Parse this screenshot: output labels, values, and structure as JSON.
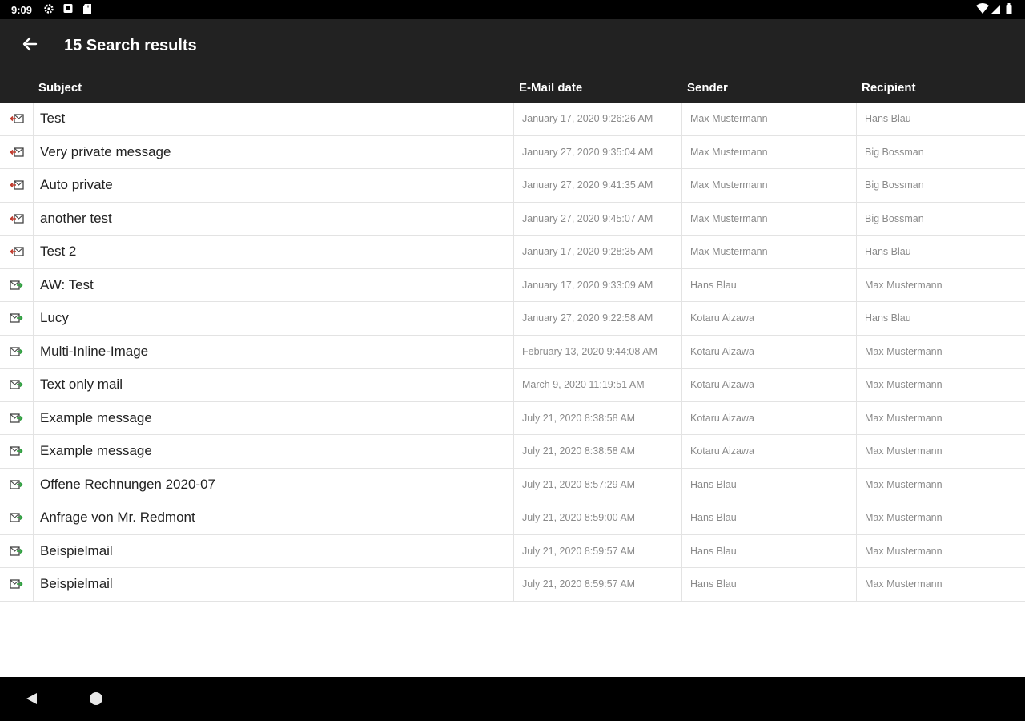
{
  "status_bar": {
    "time": "9:09",
    "left_icons": [
      "gear-icon",
      "notification-icon",
      "sd-card-icon"
    ],
    "right_icons": [
      "wifi-icon",
      "signal-icon",
      "battery-icon"
    ]
  },
  "header": {
    "title": "15 Search results",
    "back_icon": "arrow-left-icon"
  },
  "table": {
    "columns": [
      "Subject",
      "E-Mail date",
      "Sender",
      "Recipient"
    ],
    "colors": {
      "outgoing": "#c0392b",
      "incoming": "#2e9e3e"
    },
    "rows": [
      {
        "direction": "outgoing",
        "icon": "mail-out-icon",
        "subject": "Test",
        "date": "January 17, 2020 9:26:26 AM",
        "sender": "Max Mustermann",
        "recipient": "Hans Blau"
      },
      {
        "direction": "outgoing",
        "icon": "mail-out-icon",
        "subject": "Very private message",
        "date": "January 27, 2020 9:35:04 AM",
        "sender": "Max Mustermann",
        "recipient": "Big Bossman"
      },
      {
        "direction": "outgoing",
        "icon": "mail-out-icon",
        "subject": "Auto private",
        "date": "January 27, 2020 9:41:35 AM",
        "sender": "Max Mustermann",
        "recipient": "Big Bossman"
      },
      {
        "direction": "outgoing",
        "icon": "mail-out-icon",
        "subject": "another test",
        "date": "January 27, 2020 9:45:07 AM",
        "sender": "Max Mustermann",
        "recipient": "Big Bossman"
      },
      {
        "direction": "outgoing",
        "icon": "mail-out-icon",
        "subject": "Test 2",
        "date": "January 17, 2020 9:28:35 AM",
        "sender": "Max Mustermann",
        "recipient": "Hans Blau"
      },
      {
        "direction": "incoming",
        "icon": "mail-in-icon",
        "subject": "AW: Test",
        "date": "January 17, 2020 9:33:09 AM",
        "sender": "Hans Blau",
        "recipient": "Max Mustermann"
      },
      {
        "direction": "incoming",
        "icon": "mail-in-icon",
        "subject": "Lucy",
        "date": "January 27, 2020 9:22:58 AM",
        "sender": "Kotaru Aizawa",
        "recipient": "Hans Blau"
      },
      {
        "direction": "incoming",
        "icon": "mail-in-icon",
        "subject": "Multi-Inline-Image",
        "date": "February 13, 2020 9:44:08 AM",
        "sender": "Kotaru Aizawa",
        "recipient": "Max Mustermann"
      },
      {
        "direction": "incoming",
        "icon": "mail-in-icon",
        "subject": "Text only mail",
        "date": "March 9, 2020 11:19:51 AM",
        "sender": "Kotaru Aizawa",
        "recipient": "Max Mustermann"
      },
      {
        "direction": "incoming",
        "icon": "mail-in-icon",
        "subject": "Example message",
        "date": "July 21, 2020 8:38:58 AM",
        "sender": "Kotaru Aizawa",
        "recipient": "Max Mustermann"
      },
      {
        "direction": "incoming",
        "icon": "mail-in-icon",
        "subject": "Example message",
        "date": "July 21, 2020 8:38:58 AM",
        "sender": "Kotaru Aizawa",
        "recipient": "Max Mustermann"
      },
      {
        "direction": "incoming",
        "icon": "mail-in-icon",
        "subject": "Offene Rechnungen 2020-07",
        "date": "July 21, 2020 8:57:29 AM",
        "sender": "Hans Blau",
        "recipient": "Max Mustermann"
      },
      {
        "direction": "incoming",
        "icon": "mail-in-icon",
        "subject": "Anfrage von Mr. Redmont",
        "date": "July 21, 2020 8:59:00 AM",
        "sender": "Hans Blau",
        "recipient": "Max Mustermann"
      },
      {
        "direction": "incoming",
        "icon": "mail-in-icon",
        "subject": "Beispielmail",
        "date": "July 21, 2020 8:59:57 AM",
        "sender": "Hans Blau",
        "recipient": "Max Mustermann"
      },
      {
        "direction": "incoming",
        "icon": "mail-in-icon",
        "subject": "Beispielmail",
        "date": "July 21, 2020 8:59:57 AM",
        "sender": "Hans Blau",
        "recipient": "Max Mustermann"
      }
    ]
  },
  "nav_bar": {
    "icons": [
      "nav-back-icon",
      "nav-home-icon"
    ]
  }
}
